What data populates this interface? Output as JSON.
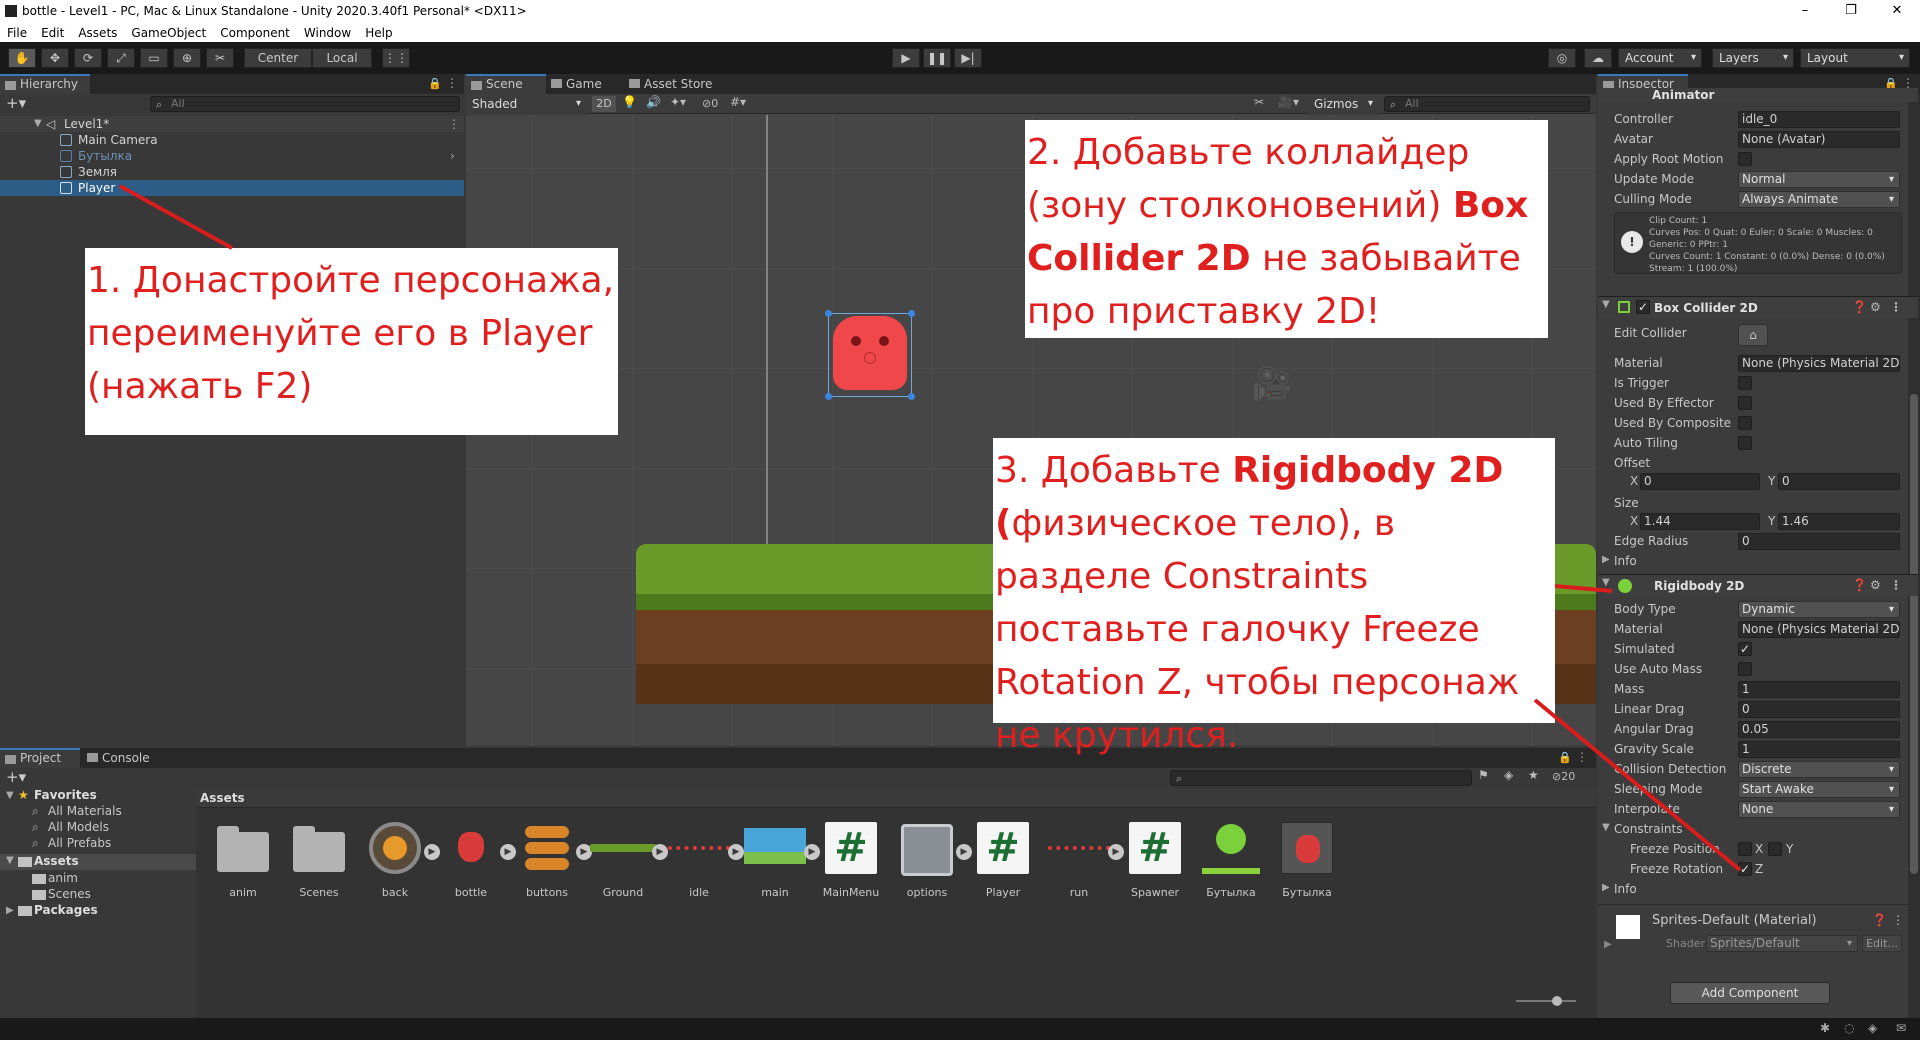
{
  "window": {
    "title": "bottle - Level1 - PC, Mac & Linux Standalone - Unity 2020.3.40f1 Personal* <DX11>",
    "controls": [
      "–",
      "❐",
      "✕"
    ]
  },
  "menu": [
    "File",
    "Edit",
    "Assets",
    "GameObject",
    "Component",
    "Window",
    "Help"
  ],
  "toolbar": {
    "center_label": "Center",
    "local_label": "Local",
    "account_label": "Account",
    "layers_label": "Layers",
    "layout_label": "Layout"
  },
  "hierarchy": {
    "tab": "Hierarchy",
    "search_placeholder": "All",
    "scene": "Level1*",
    "items": [
      "Main Camera",
      "Бутылка",
      "Земля",
      "Player"
    ]
  },
  "scene": {
    "tabs": [
      "Scene",
      "Game",
      "Asset Store"
    ],
    "shading": "Shaded",
    "mode_2d": "2D",
    "fx_count": "0",
    "gizmos": "Gizmos",
    "search_placeholder": "All"
  },
  "annotations": {
    "a1": "1. Донастройте персонажа, переименуйте его в Player (нажать F2)",
    "a2_pre": "2. Добавьте коллайдер (зону столконовений) ",
    "a2_bold": "Box Collider 2D",
    "a2_post": " не забывайте про приставку 2D!",
    "a3_pre": "3. Добавьте ",
    "a3_bold": "Rigidbody 2D (",
    "a3_post": "физическое тело), в разделе Constraints поставьте галочку Freeze Rotation Z, чтобы персонаж не крутился."
  },
  "inspector": {
    "tab": "Inspector",
    "animator": {
      "title": "Animator",
      "controller_label": "Controller",
      "controller_value": "idle_0",
      "avatar_label": "Avatar",
      "avatar_value": "None (Avatar)",
      "apply_root_label": "Apply Root Motion",
      "update_label": "Update Mode",
      "update_value": "Normal",
      "culling_label": "Culling Mode",
      "culling_value": "Always Animate",
      "info_lines": [
        "Clip Count: 1",
        "Curves Pos: 0 Quat: 0 Euler: 0 Scale: 0 Muscles: 0",
        "Generic: 0 PPtr: 1",
        "Curves Count: 1 Constant: 0 (0.0%) Dense: 0 (0.0%)",
        "Stream: 1 (100.0%)"
      ]
    },
    "box_collider": {
      "title": "Box Collider 2D",
      "edit_collider": "Edit Collider",
      "material_label": "Material",
      "material_value": "None (Physics Material 2D)",
      "is_trigger": "Is Trigger",
      "used_by_effector": "Used By Effector",
      "used_by_composite": "Used By Composite",
      "auto_tiling": "Auto Tiling",
      "offset_label": "Offset",
      "offset_x": "0",
      "offset_y": "0",
      "size_label": "Size",
      "size_x": "1.44",
      "size_y": "1.46",
      "edge_radius_label": "Edge Radius",
      "edge_radius_value": "0",
      "info": "Info",
      "x": "X",
      "y": "Y"
    },
    "rigidbody": {
      "title": "Rigidbody 2D",
      "body_type_label": "Body Type",
      "body_type_value": "Dynamic",
      "material_label": "Material",
      "material_value": "None (Physics Material 2D)",
      "simulated_label": "Simulated",
      "use_auto_mass_label": "Use Auto Mass",
      "mass_label": "Mass",
      "mass_value": "1",
      "linear_drag_label": "Linear Drag",
      "linear_drag_value": "0",
      "angular_drag_label": "Angular Drag",
      "angular_drag_value": "0.05",
      "gravity_label": "Gravity Scale",
      "gravity_value": "1",
      "collision_label": "Collision Detection",
      "collision_value": "Discrete",
      "sleeping_label": "Sleeping Mode",
      "sleeping_value": "Start Awake",
      "interpolate_label": "Interpolate",
      "interpolate_value": "None",
      "constraints_label": "Constraints",
      "freeze_pos_label": "Freeze Position",
      "freeze_rot_label": "Freeze Rotation",
      "x": "X",
      "y": "Y",
      "z": "Z",
      "info": "Info"
    },
    "material": {
      "name": "Sprites-Default (Material)",
      "shader_label": "Shader",
      "shader_value": "Sprites/Default",
      "edit": "Edit..."
    },
    "add_component": "Add Component"
  },
  "project": {
    "tabs": [
      "Project",
      "Console"
    ],
    "favorites": "Favorites",
    "fav_items": [
      "All Materials",
      "All Models",
      "All Prefabs"
    ],
    "assets": "Assets",
    "asset_folders": [
      "anim",
      "Scenes"
    ],
    "packages": "Packages",
    "breadcrumb": "Assets",
    "count": "20",
    "grid": [
      "anim",
      "Scenes",
      "back",
      "bottle",
      "buttons",
      "Ground",
      "idle",
      "main",
      "MainMenu",
      "options",
      "Player",
      "run",
      "Spawner",
      "Бутылка",
      "Бутылка"
    ]
  },
  "colors": {
    "accent": "#2c5d87",
    "annotation_text": "#e01f1f",
    "player_sprite": "#f0474b"
  }
}
